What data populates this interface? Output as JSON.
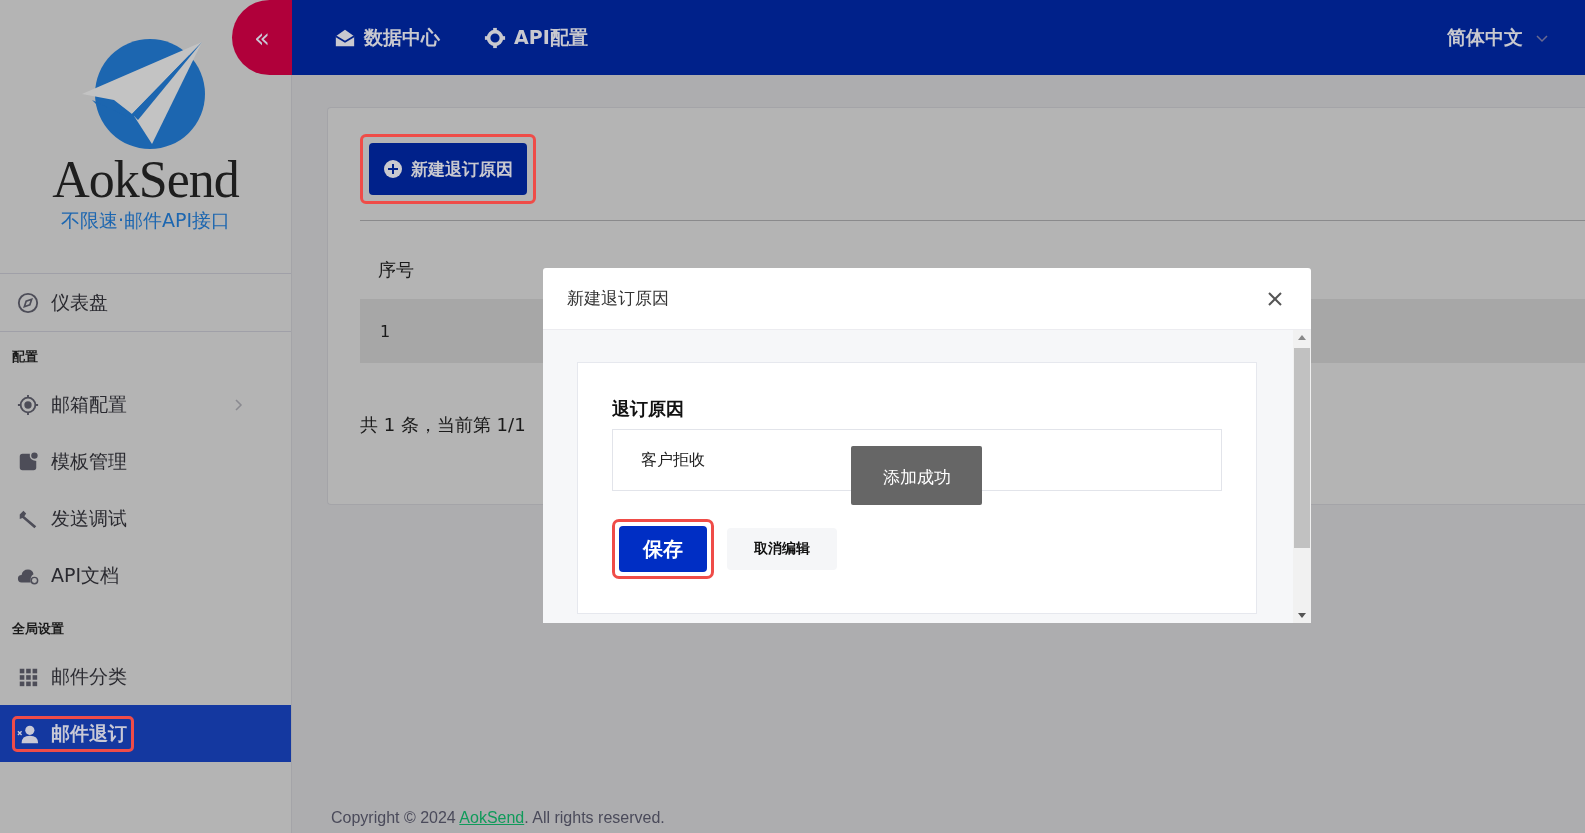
{
  "sidebar": {
    "logo": {
      "wordmark": "AokSend",
      "tagline": "不限速·邮件API接口"
    },
    "collapse_button": "«",
    "items": [
      {
        "kind": "link",
        "label": "仪表盘",
        "selected": false,
        "expandable": false,
        "highlighted": false
      },
      {
        "kind": "section",
        "label": "配置"
      },
      {
        "kind": "link",
        "label": "邮箱配置",
        "selected": false,
        "expandable": true,
        "highlighted": false
      },
      {
        "kind": "link",
        "label": "模板管理",
        "selected": false,
        "expandable": false,
        "highlighted": false
      },
      {
        "kind": "link",
        "label": "发送调试",
        "selected": false,
        "expandable": false,
        "highlighted": false
      },
      {
        "kind": "link",
        "label": "API文档",
        "selected": false,
        "expandable": false,
        "highlighted": false
      },
      {
        "kind": "section",
        "label": "全局设置"
      },
      {
        "kind": "link",
        "label": "邮件分类",
        "selected": false,
        "expandable": false,
        "highlighted": false
      },
      {
        "kind": "link",
        "label": "邮件退订",
        "selected": true,
        "expandable": false,
        "highlighted": true
      }
    ]
  },
  "top_nav": {
    "items": [
      {
        "label": "数据中心"
      },
      {
        "label": "API配置"
      }
    ],
    "language": "简体中文"
  },
  "content": {
    "new_button": {
      "label": "新建退订原因",
      "highlighted": true
    },
    "table": {
      "columns": [
        "序号"
      ],
      "rows": [
        [
          "1"
        ]
      ]
    },
    "pagination": "共 1 条，当前第 1/1"
  },
  "modal": {
    "title": "新建退订原因",
    "field_label": "退订原因",
    "field_value": "客户拒收",
    "buttons": [
      {
        "kind": "primary",
        "label": "保存",
        "highlighted": true
      },
      {
        "kind": "secondary",
        "label": "取消编辑",
        "highlighted": false
      }
    ],
    "toast": "添加成功"
  },
  "footer": {
    "before": "Copyright © 2024 ",
    "link": "AokSend",
    "after": ". All rights reserved."
  }
}
